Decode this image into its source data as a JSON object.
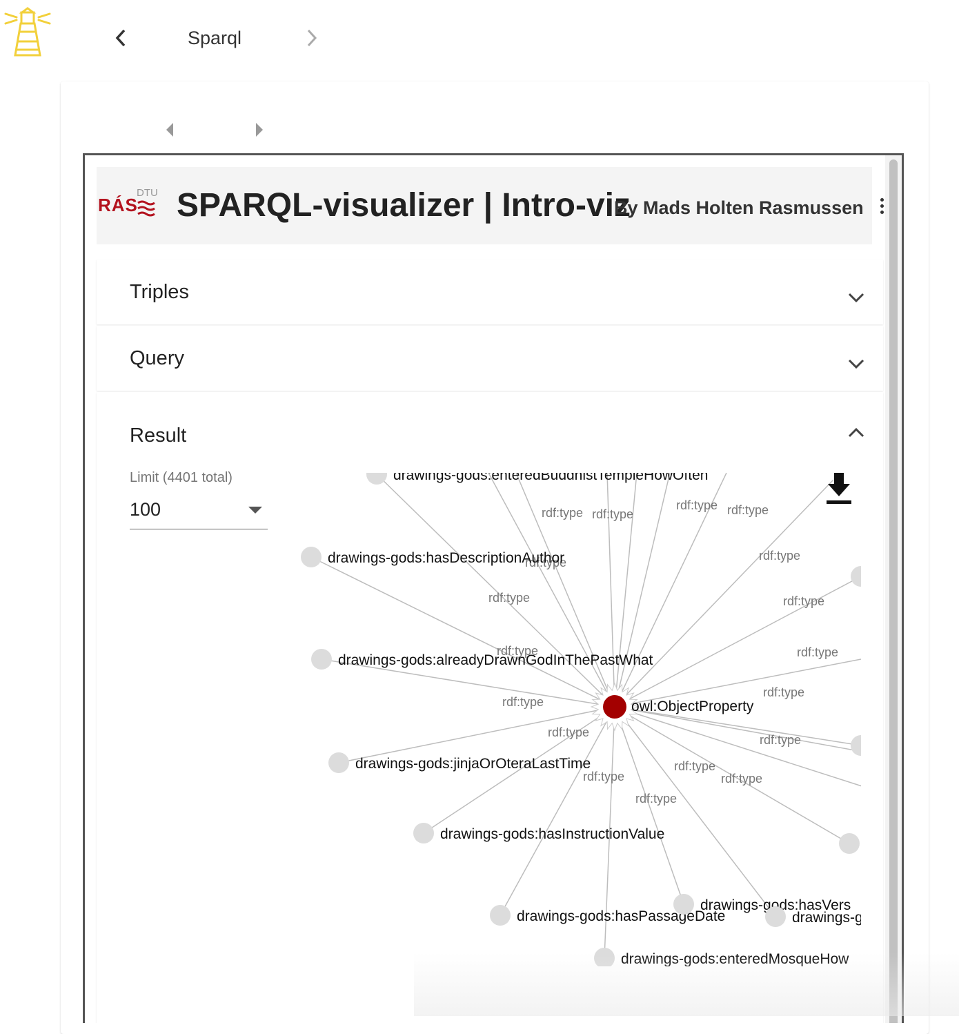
{
  "topbar": {
    "title": "Sparql"
  },
  "app": {
    "brand_ras": "RÁS",
    "brand_dtu": "DTU",
    "title": "SPARQL-visualizer | Intro-viz",
    "author": "By Mads Holten Rasmussen"
  },
  "panels": {
    "triples": "Triples",
    "query": "Query",
    "result": "Result"
  },
  "limit": {
    "label": "Limit (4401 total)",
    "value": "100"
  },
  "colors": {
    "center_node": "#a30000",
    "node": "#dcdcdc",
    "edge": "#bdbdbd",
    "logo": "#f2d03b"
  },
  "graph": {
    "center_label": "owl:ObjectProperty",
    "edge_label": "rdf:type",
    "nodes": [
      "drawings-gods:enteredBuddhistTempleHowOften",
      "drawings-gods:hasDescriptionAuthor",
      "drawings-gods:alreadyDrawnGodInThePastWhat",
      "drawings-gods:jinjaOrOteraLastTime",
      "drawings-gods:hasInstructionValue",
      "drawings-gods:hasPassageDate",
      "drawings-gods:enteredMosqueHow",
      "drawings-gods:hasVers",
      "drawings-g"
    ]
  }
}
